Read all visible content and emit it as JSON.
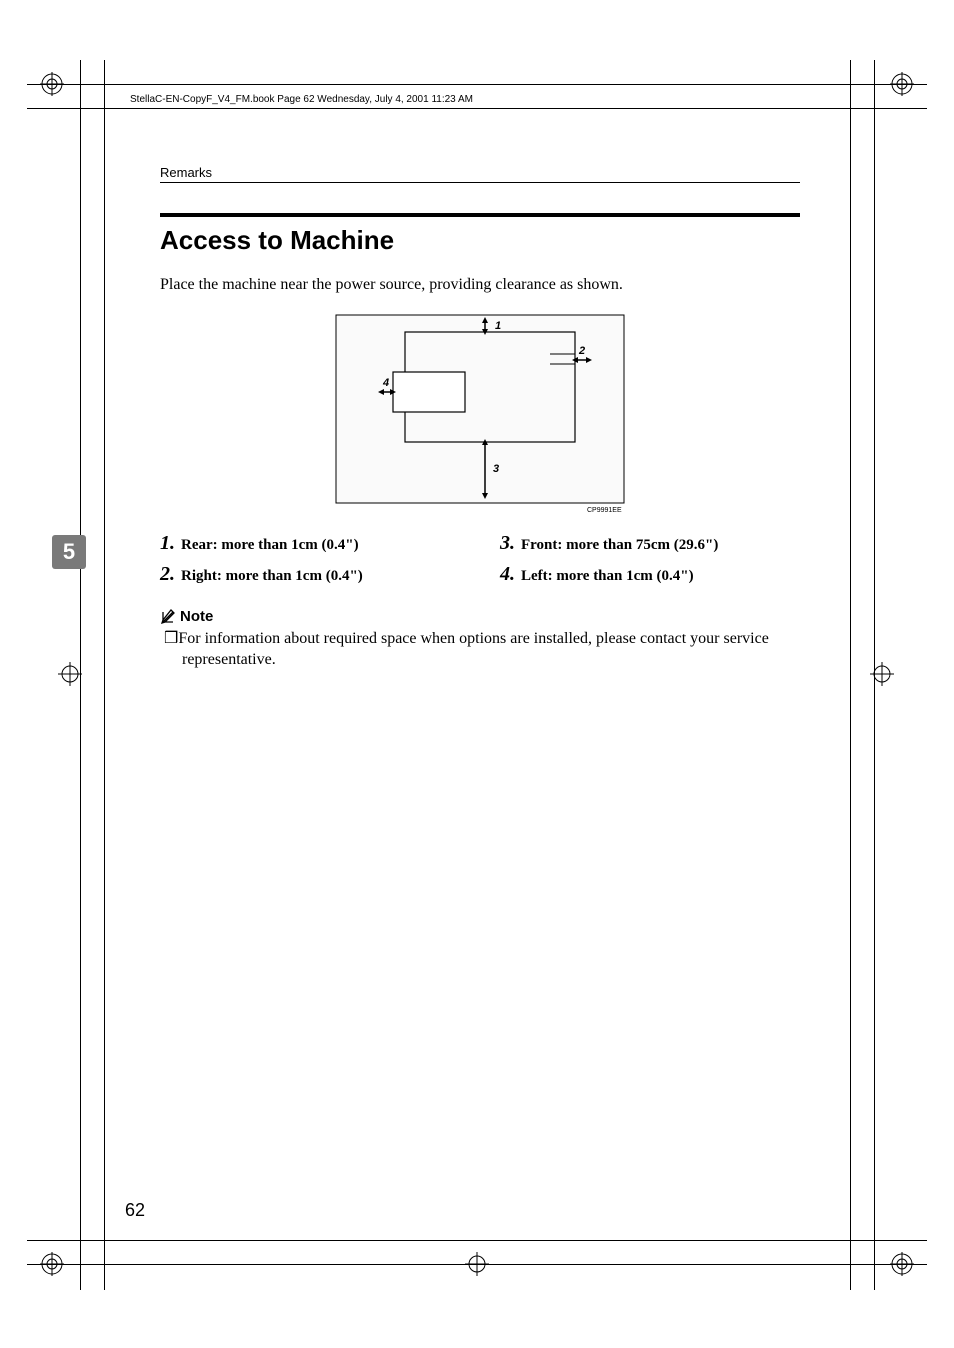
{
  "print_header": "StellaC-EN-CopyF_V4_FM.book  Page 62  Wednesday, July 4, 2001  11:23 AM",
  "running_header": "Remarks",
  "section_title": "Access to Machine",
  "intro": "Place the machine near the power source, providing clearance as shown.",
  "diagram_code": "CP9991EE",
  "clearances": {
    "left_col": [
      {
        "num": "1.",
        "text": "Rear: more than 1cm (0.4\")"
      },
      {
        "num": "2.",
        "text": "Right: more than 1cm (0.4\")"
      }
    ],
    "right_col": [
      {
        "num": "3.",
        "text": "Front: more than 75cm (29.6\")"
      },
      {
        "num": "4.",
        "text": "Left: more than 1cm (0.4\")"
      }
    ]
  },
  "note_label": "Note",
  "note_text": "For information about required space when options are installed, please contact your service representative.",
  "side_tab": "5",
  "page_number": "62"
}
